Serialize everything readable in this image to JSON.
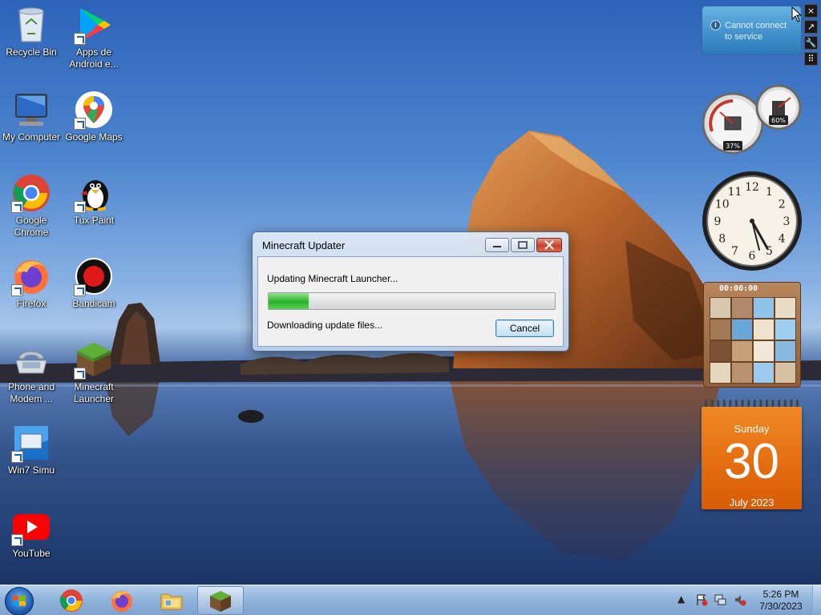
{
  "desktop": {
    "icons": [
      {
        "label": "Recycle Bin",
        "icon": "recycle-bin-icon"
      },
      {
        "label": "Apps de Android e...",
        "icon": "google-play-icon"
      },
      {
        "label": "My Computer",
        "icon": "computer-icon"
      },
      {
        "label": "Google Maps",
        "icon": "google-maps-icon"
      },
      {
        "label": "Google Chrome",
        "icon": "chrome-icon"
      },
      {
        "label": "Tux Paint",
        "icon": "tux-paint-icon"
      },
      {
        "label": "Firefox",
        "icon": "firefox-icon"
      },
      {
        "label": "Bandicam",
        "icon": "bandicam-icon"
      },
      {
        "label": "Phone and Modem ...",
        "icon": "phone-modem-icon"
      },
      {
        "label": "Minecraft Launcher",
        "icon": "minecraft-icon"
      },
      {
        "label": "Win7 Simu",
        "icon": "win7-simu-icon"
      },
      {
        "label": "YouTube",
        "icon": "youtube-icon"
      }
    ]
  },
  "dialog": {
    "title": "Minecraft Updater",
    "message": "Updating Minecraft Launcher...",
    "status": "Downloading update files...",
    "cancel_label": "Cancel",
    "progress": 0.14,
    "progress_color": "#27b327"
  },
  "gadgets": {
    "feed": {
      "text_line1": "Cannot connect",
      "text_line2": "to service",
      "info": "i"
    },
    "meter": {
      "cpu": "37%",
      "memory": "60%"
    },
    "clock": {
      "numbers": [
        "12",
        "1",
        "2",
        "3",
        "4",
        "5",
        "6",
        "7",
        "8",
        "9",
        "10",
        "11"
      ],
      "time": "5:26"
    },
    "puzzle": {
      "time": "00:00:00"
    },
    "calendar": {
      "day": "Sunday",
      "date": "30",
      "month_year": "July 2023",
      "color": "#e36b0f"
    },
    "sidebar_buttons": [
      "×",
      "↗",
      "🔧",
      "⠿"
    ]
  },
  "taskbar": {
    "pinned": [
      {
        "name": "chrome",
        "icon": "chrome-icon"
      },
      {
        "name": "firefox",
        "icon": "firefox-icon"
      },
      {
        "name": "explorer",
        "icon": "folder-icon"
      },
      {
        "name": "minecraft",
        "icon": "minecraft-icon"
      }
    ],
    "time": "5:26 PM",
    "date": "7/30/2023"
  }
}
